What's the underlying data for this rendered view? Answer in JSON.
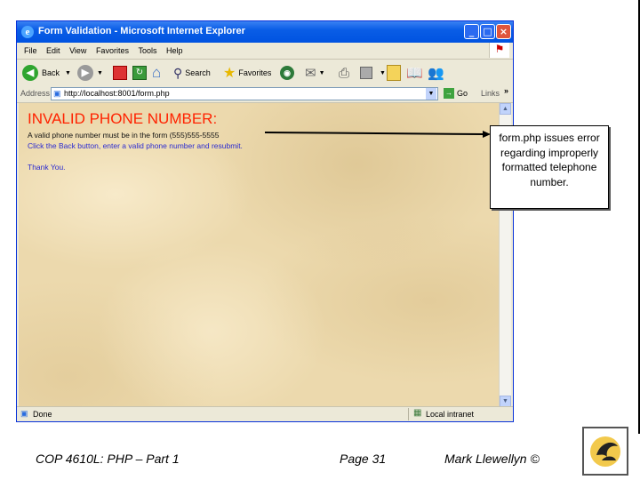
{
  "window": {
    "title": "Form Validation - Microsoft Internet Explorer",
    "controls": {
      "minimize": "_",
      "maximize": "□",
      "close": "×"
    }
  },
  "menu": [
    "File",
    "Edit",
    "View",
    "Favorites",
    "Tools",
    "Help"
  ],
  "toolbar": {
    "back_label": "Back",
    "search_label": "Search",
    "favorites_label": "Favorites"
  },
  "address": {
    "label": "Address",
    "url": "http://localhost:8001/form.php",
    "go_label": "Go",
    "links_label": "Links"
  },
  "page": {
    "heading": "INVALID PHONE NUMBER:",
    "line1": "A valid phone number must be in the form (555)555-5555",
    "line2": "Click the Back button, enter a valid phone number and resubmit.",
    "line3": "Thank You."
  },
  "status": {
    "left": "Done",
    "right": "Local intranet"
  },
  "callout": {
    "text": "form.php issues error regarding improperly formatted telephone number."
  },
  "footer": {
    "course": "COP 4610L:  PHP – Part 1",
    "page": "Page 31",
    "author": "Mark Llewellyn ©"
  },
  "colors": {
    "heading": "#ff2200",
    "link_text": "#2a2ad0",
    "titlebar": "#0a5de6"
  }
}
